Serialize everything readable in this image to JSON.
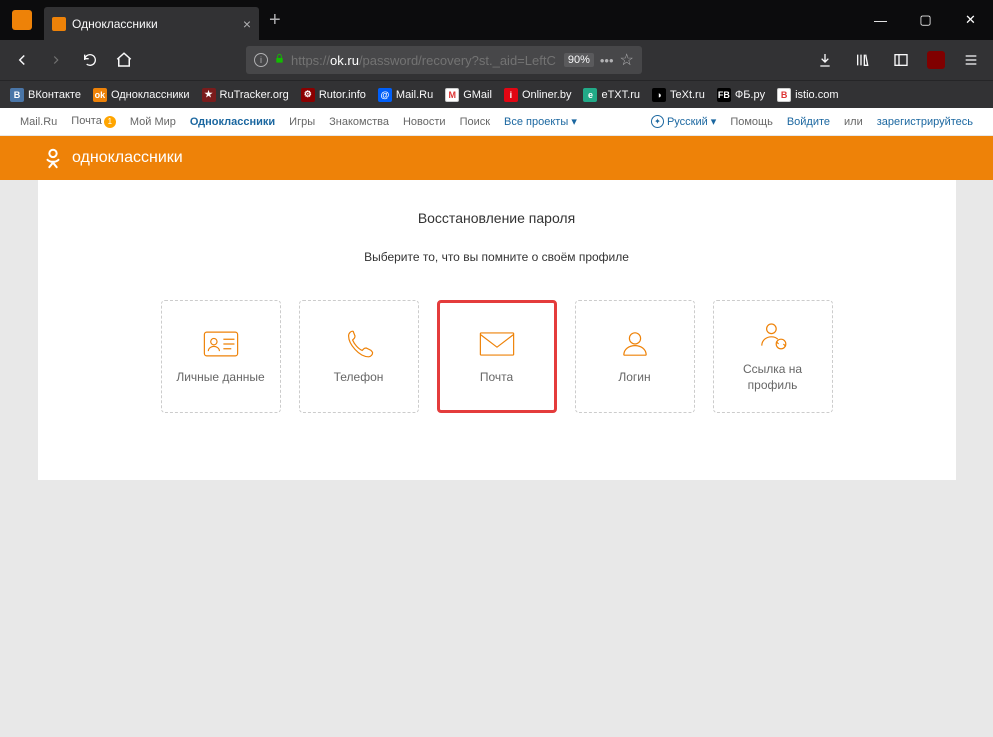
{
  "tab": {
    "title": "Одноклассники"
  },
  "urlbar": {
    "url_proto": "https://",
    "url_host": "ok.ru",
    "url_path": "/password/recovery?st._aid=LeftC",
    "zoom": "90%"
  },
  "bookmarks": [
    {
      "label": "ВКонтакте",
      "bg": "#4a76a8",
      "g": "B"
    },
    {
      "label": "Одноклассники",
      "bg": "#ee8208",
      "g": "ok"
    },
    {
      "label": "RuTracker.org",
      "bg": "#7a1c1c",
      "g": "★"
    },
    {
      "label": "Rutor.info",
      "bg": "#8b0000",
      "g": "⚙"
    },
    {
      "label": "Mail.Ru",
      "bg": "#005ff9",
      "g": "@"
    },
    {
      "label": "GMail",
      "bg": "#fff",
      "g": "M"
    },
    {
      "label": "Onliner.by",
      "bg": "#e30613",
      "g": "i"
    },
    {
      "label": "eTXT.ru",
      "bg": "#2a8",
      "g": "e"
    },
    {
      "label": "TeXt.ru",
      "bg": "#000",
      "g": "◑"
    },
    {
      "label": "ФБ.py",
      "bg": "#000",
      "g": "FB"
    },
    {
      "label": "istio.com",
      "bg": "#fff",
      "g": "B"
    }
  ],
  "portal": {
    "links": [
      "Mail.Ru",
      "Почта",
      "Мой Мир",
      "Одноклассники",
      "Игры",
      "Знакомства",
      "Новости",
      "Поиск",
      "Все проекты"
    ],
    "notif": "1",
    "lang": "Русский",
    "help": "Помощь",
    "login": "Войдите",
    "or": "или",
    "register": "зарегистрируйтесь"
  },
  "brand": "одноклассники",
  "card": {
    "title": "Восстановление пароля",
    "subtitle": "Выберите то, что вы помните о своём профиле"
  },
  "options": [
    {
      "id": "personal",
      "label": "Личные данные"
    },
    {
      "id": "phone",
      "label": "Телефон"
    },
    {
      "id": "email",
      "label": "Почта"
    },
    {
      "id": "login",
      "label": "Логин"
    },
    {
      "id": "profile-link",
      "label": "Ссылка на профиль"
    }
  ]
}
